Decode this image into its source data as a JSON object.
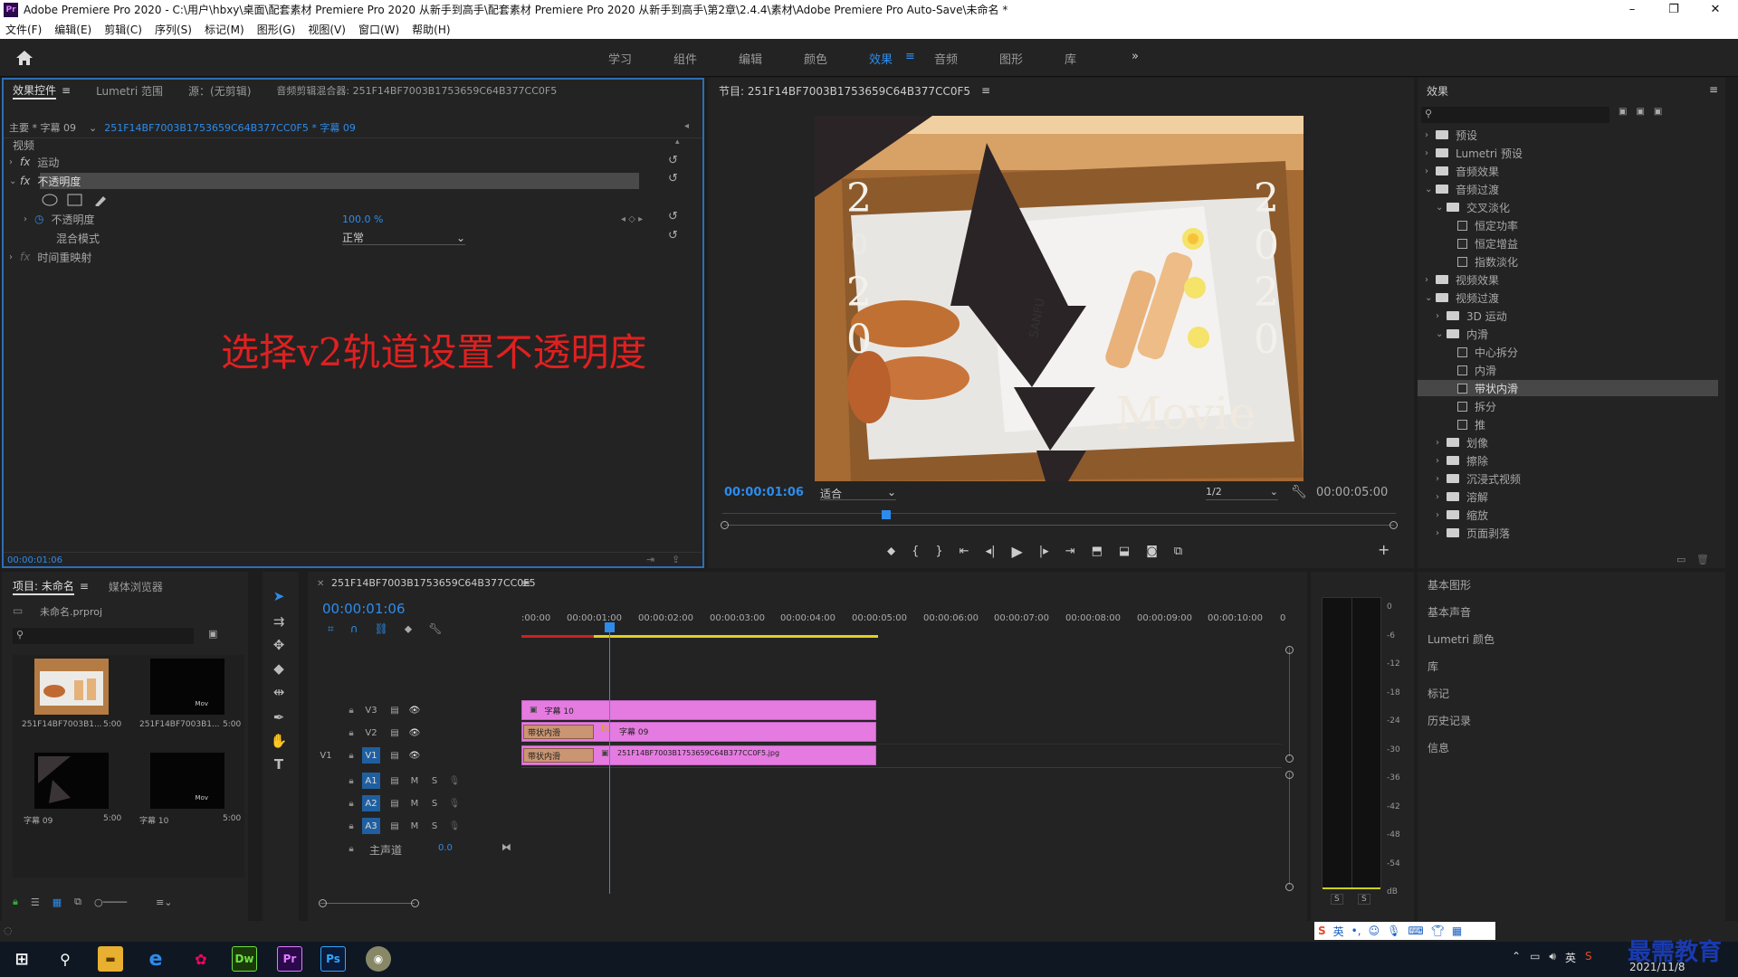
{
  "window": {
    "title": "Adobe Premiere Pro 2020 - C:\\用户\\hbxy\\桌面\\配套素材 Premiere Pro 2020 从新手到高手\\配套素材 Premiere Pro 2020 从新手到高手\\第2章\\2.4.4\\素材\\Adobe Premiere Pro Auto-Save\\未命名 *",
    "logo": "Pr",
    "minimize": "–",
    "maximize": "❐",
    "close": "✕"
  },
  "menu": [
    "文件(F)",
    "编辑(E)",
    "剪辑(C)",
    "序列(S)",
    "标记(M)",
    "图形(G)",
    "视图(V)",
    "窗口(W)",
    "帮助(H)"
  ],
  "workspaces": [
    "学习",
    "组件",
    "编辑",
    "颜色",
    "效果",
    "音频",
    "图形",
    "库"
  ],
  "active_workspace": "效果",
  "overflow": "»",
  "effect_controls": {
    "tabs": [
      "效果控件",
      "Lumetri 范围",
      "源：(无剪辑)",
      "音频剪辑混合器: 251F14BF7003B1753659C64B377CC0F5"
    ],
    "master": "主要 * 字幕 09",
    "sequence": "251F14BF7003B1753659C64B377CC0F5 * 字幕 09",
    "section_video": "视频",
    "motion": "运动",
    "opacity": "不透明度",
    "opacity_prop": "不透明度",
    "opacity_value": "100.0 %",
    "blend_mode_label": "混合模式",
    "blend_mode_value": "正常",
    "time_remap": "时间重映射",
    "fx": "fx",
    "timecode": "00:00:01:06"
  },
  "annotation": "选择v2轨道设置不透明度",
  "program": {
    "title": "节目: 251F14BF7003B1753659C64B377CC0F5",
    "timecode": "00:00:01:06",
    "fit": "适合",
    "quality": "1/2",
    "duration": "00:00:05:00",
    "overlay_left": [
      "2",
      "0",
      "2",
      "0"
    ],
    "overlay_right": [
      "2",
      "0",
      "2",
      "0"
    ],
    "overlay_movie": "Movie",
    "plate_brand": "SANFU"
  },
  "effects_panel": {
    "title": "效果",
    "items": [
      {
        "label": "预设",
        "level": 0,
        "type": "folder",
        "open": false
      },
      {
        "label": "Lumetri 预设",
        "level": 0,
        "type": "folder",
        "open": false
      },
      {
        "label": "音频效果",
        "level": 0,
        "type": "folder",
        "open": false
      },
      {
        "label": "音频过渡",
        "level": 0,
        "type": "folder",
        "open": true
      },
      {
        "label": "交叉淡化",
        "level": 1,
        "type": "folder",
        "open": true
      },
      {
        "label": "恒定功率",
        "level": 2,
        "type": "fx"
      },
      {
        "label": "恒定增益",
        "level": 2,
        "type": "fx"
      },
      {
        "label": "指数淡化",
        "level": 2,
        "type": "fx"
      },
      {
        "label": "视频效果",
        "level": 0,
        "type": "folder",
        "open": false
      },
      {
        "label": "视频过渡",
        "level": 0,
        "type": "folder",
        "open": true
      },
      {
        "label": "3D 运动",
        "level": 1,
        "type": "folder",
        "open": false
      },
      {
        "label": "内滑",
        "level": 1,
        "type": "folder",
        "open": true
      },
      {
        "label": "中心拆分",
        "level": 2,
        "type": "fx"
      },
      {
        "label": "内滑",
        "level": 2,
        "type": "fx"
      },
      {
        "label": "带状内滑",
        "level": 2,
        "type": "fx",
        "selected": true
      },
      {
        "label": "拆分",
        "level": 2,
        "type": "fx"
      },
      {
        "label": "推",
        "level": 2,
        "type": "fx"
      },
      {
        "label": "划像",
        "level": 1,
        "type": "folder",
        "open": false
      },
      {
        "label": "擦除",
        "level": 1,
        "type": "folder",
        "open": false
      },
      {
        "label": "沉浸式视频",
        "level": 1,
        "type": "folder",
        "open": false
      },
      {
        "label": "溶解",
        "level": 1,
        "type": "folder",
        "open": false
      },
      {
        "label": "缩放",
        "level": 1,
        "type": "folder",
        "open": false
      },
      {
        "label": "页面剥落",
        "level": 1,
        "type": "folder",
        "open": false
      }
    ],
    "lower_panels": [
      "基本图形",
      "基本声音",
      "Lumetri 颜色",
      "库",
      "标记",
      "历史记录",
      "信息"
    ]
  },
  "project": {
    "tabs": [
      "项目: 未命名",
      "媒体浏览器"
    ],
    "file": "未命名.prproj",
    "items": [
      {
        "name": "251F14BF7003B1...",
        "dur": "5:00"
      },
      {
        "name": "251F14BF7003B1...",
        "dur": "5:00"
      },
      {
        "name": "字幕 09",
        "dur": "5:00"
      },
      {
        "name": "字幕 10",
        "dur": "5:00"
      }
    ]
  },
  "timeline": {
    "tab": "251F14BF7003B1753659C64B377CC0F5",
    "timecode": "00:00:01:06",
    "ruler": [
      ":00:00",
      "00:00:01:00",
      "00:00:02:00",
      "00:00:03:00",
      "00:00:04:00",
      "00:00:05:00",
      "00:00:06:00",
      "00:00:07:00",
      "00:00:08:00",
      "00:00:09:00",
      "00:00:10:00",
      "0"
    ],
    "video_tracks": [
      "V3",
      "V2",
      "V1"
    ],
    "audio_tracks": [
      "A1",
      "A2",
      "A3"
    ],
    "source_v": "V1",
    "master": "主声道",
    "master_value": "0.0",
    "clip_v3": "字幕 10",
    "clip_v2": "字幕 09",
    "clip_v1": "251F14BF7003B1753659C64B377CC0F5.jpg",
    "transition": "带状内滑",
    "btn_m": "M",
    "btn_s": "S"
  },
  "meter": {
    "scale": [
      "0",
      "-6",
      "-12",
      "-18",
      "-24",
      "-30",
      "-36",
      "-42",
      "-48",
      "-54",
      "dB"
    ],
    "solo": [
      "S",
      "S"
    ]
  },
  "taskbar": {
    "date": "2021/11/8",
    "watermark": "最需教育",
    "ime": "英"
  }
}
